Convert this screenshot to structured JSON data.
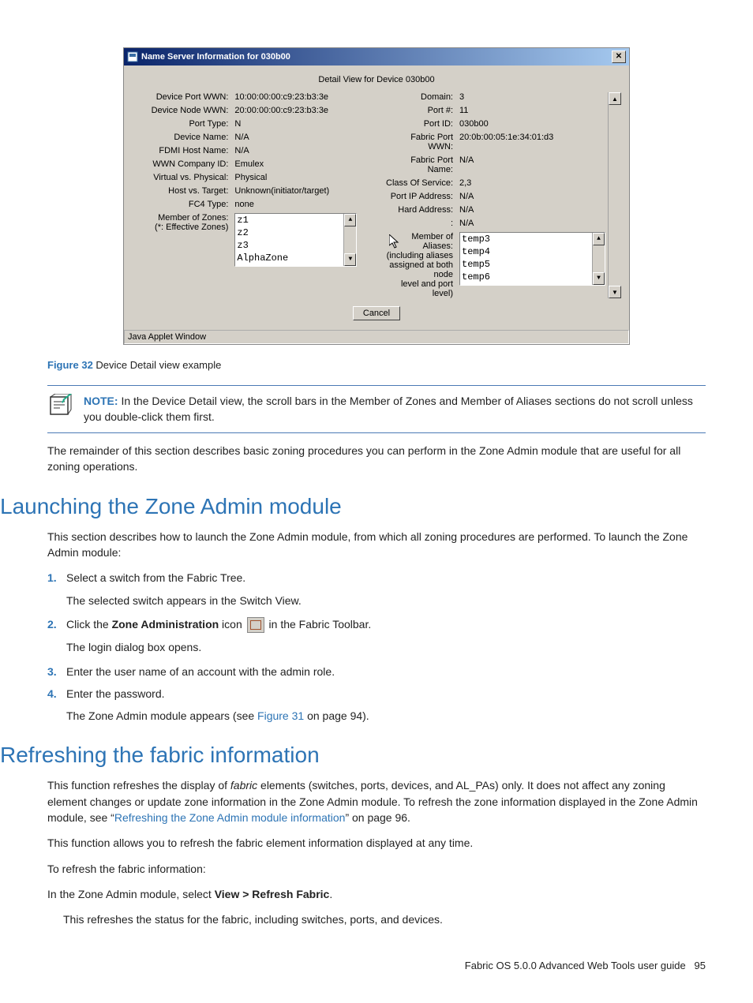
{
  "dialog": {
    "title": "Name Server Information for 030b00",
    "subtitle": "Detail View for Device 030b00",
    "left": [
      {
        "label": "Device Port WWN:",
        "value": "10:00:00:00:c9:23:b3:3e"
      },
      {
        "label": "Device Node WWN:",
        "value": "20:00:00:00:c9:23:b3:3e"
      },
      {
        "label": "Port Type:",
        "value": "N"
      },
      {
        "label": "Device Name:",
        "value": "N/A"
      },
      {
        "label": "FDMI Host Name:",
        "value": "N/A"
      },
      {
        "label": "WWN Company ID:",
        "value": "Emulex"
      },
      {
        "label": "Virtual vs. Physical:",
        "value": "Physical"
      },
      {
        "label": "Host vs. Target:",
        "value": "Unknown(initiator/target)"
      },
      {
        "label": "FC4 Type:",
        "value": "none"
      }
    ],
    "right": [
      {
        "label": "Domain:",
        "value": "3"
      },
      {
        "label": "Port #:",
        "value": "11"
      },
      {
        "label": "Port ID:",
        "value": "030b00"
      },
      {
        "label": "Fabric Port WWN:",
        "value": "20:0b:00:05:1e:34:01:d3"
      },
      {
        "label": "Fabric Port Name:",
        "value": "N/A"
      },
      {
        "label": "Class Of Service:",
        "value": "2,3"
      },
      {
        "label": "Port IP Address:",
        "value": "N/A"
      },
      {
        "label": "Hard Address:",
        "value": "N/A"
      },
      {
        "label": ":",
        "value": "N/A"
      }
    ],
    "zones_label": "Member of Zones:",
    "zones_label2": "(*: Effective Zones)",
    "zones": [
      "z1",
      "z2",
      "z3",
      "AlphaZone"
    ],
    "aliases_label_l1": "Member of Aliases:",
    "aliases_label_l2": "(including aliases",
    "aliases_label_l3": "assigned at both node",
    "aliases_label_l4": "level and port level)",
    "aliases": [
      "temp3",
      "temp4",
      "temp5",
      "temp6"
    ],
    "cancel": "Cancel",
    "applet_bar": "Java Applet Window"
  },
  "figure": {
    "num": "Figure 32",
    "text": " Device Detail view example"
  },
  "note": {
    "label": "NOTE:",
    "text": "   In the Device Detail view, the scroll bars in the Member of Zones and Member of Aliases sections do not scroll unless you double-click them first."
  },
  "remainder": "The remainder of this section describes basic zoning procedures you can perform in the Zone Admin module that are useful for all zoning operations.",
  "launching": {
    "heading": "Launching the Zone Admin module",
    "intro": "This section describes how to launch the Zone Admin module, from which all zoning procedures are performed. To launch the Zone Admin module:",
    "step1": "Select a switch from the Fabric Tree.",
    "step1_sub": "The selected switch appears in the Switch View.",
    "step2_pre": "Click the ",
    "step2_bold": "Zone Administration",
    "step2_mid": " icon ",
    "step2_post": " in the Fabric Toolbar.",
    "step2_sub": "The login dialog box opens.",
    "step3": "Enter the user name of an account with the admin role.",
    "step4": "Enter the password.",
    "step4_sub_pre": "The Zone Admin module appears (see ",
    "step4_sub_link": "Figure 31",
    "step4_sub_post": " on page 94)."
  },
  "refreshing": {
    "heading": "Refreshing the fabric information",
    "p1_pre": "This function refreshes the display of ",
    "p1_italic": "fabric",
    "p1_mid": " elements (switches, ports, devices, and AL_PAs) only. It does not affect any zoning element changes or update zone information in the Zone Admin module. To refresh the zone information displayed in the Zone Admin module, see “",
    "p1_link": "Refreshing the Zone Admin module information",
    "p1_post": "” on page 96.",
    "p2": "This function allows you to refresh the fabric element information displayed at any time.",
    "p3": "To refresh the fabric information:",
    "p4_pre": "In the Zone Admin module, select ",
    "p4_bold": "View > Refresh Fabric",
    "p4_post": ".",
    "p5": "This refreshes the status for the fabric, including switches, ports, and devices."
  },
  "footer": {
    "text": "Fabric OS 5.0.0 Advanced Web Tools user guide",
    "page": "95"
  }
}
